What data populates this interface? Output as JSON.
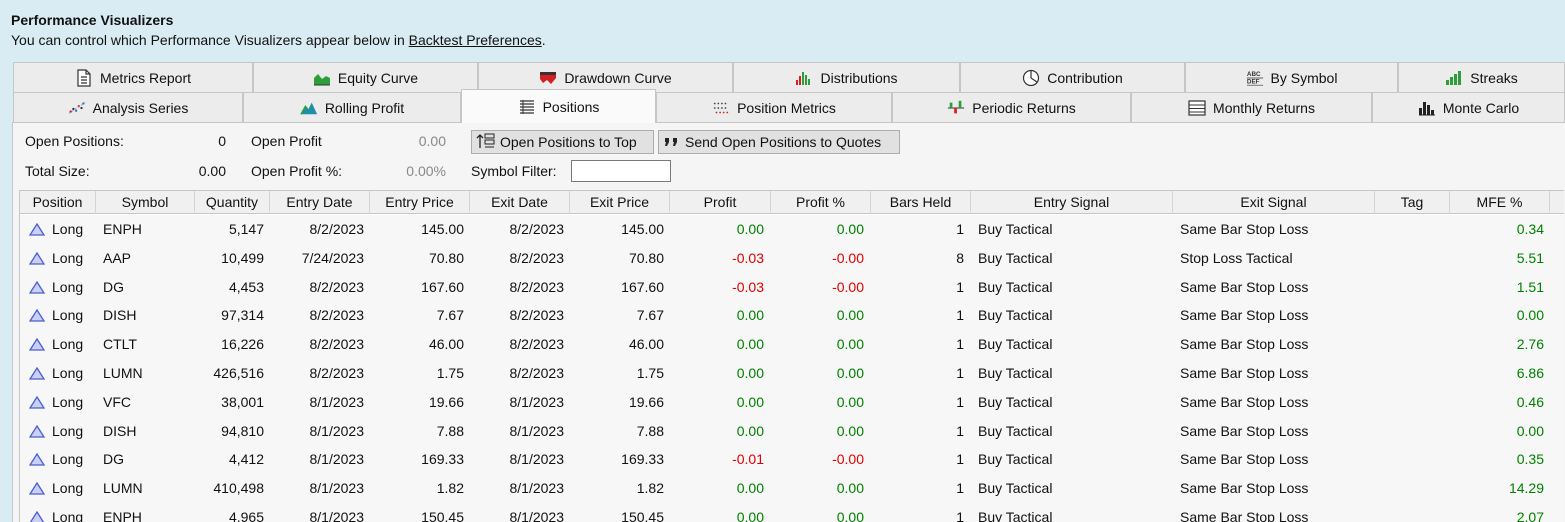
{
  "header": {
    "title": "Performance Visualizers",
    "subtitle_prefix": "You can control which Performance Visualizers appear below in ",
    "subtitle_link": "Backtest Preferences",
    "subtitle_suffix": "."
  },
  "tabs_row1": [
    {
      "label": "Metrics Report",
      "icon": "document-icon"
    },
    {
      "label": "Equity Curve",
      "icon": "area-chart-icon"
    },
    {
      "label": "Drawdown Curve",
      "icon": "drawdown-icon"
    },
    {
      "label": "Distributions",
      "icon": "histogram-icon"
    },
    {
      "label": "Contribution",
      "icon": "pie-chart-icon"
    },
    {
      "label": "By Symbol",
      "icon": "abc-table-icon"
    },
    {
      "label": "Streaks",
      "icon": "bar-chart-icon"
    }
  ],
  "tabs_row2": [
    {
      "label": "Analysis Series",
      "icon": "scatter-icon"
    },
    {
      "label": "Rolling Profit",
      "icon": "mountain-chart-icon"
    },
    {
      "label": "Positions",
      "icon": "list-icon",
      "active": true
    },
    {
      "label": "Position Metrics",
      "icon": "dots-grid-icon"
    },
    {
      "label": "Periodic Returns",
      "icon": "plus-minus-bars-icon"
    },
    {
      "label": "Monthly Returns",
      "icon": "calendar-grid-icon"
    },
    {
      "label": "Monte Carlo",
      "icon": "dark-bars-icon"
    }
  ],
  "stats": {
    "open_positions_label": "Open Positions:",
    "open_positions_value": "0",
    "open_profit_label": "Open Profit",
    "open_profit_value": "0.00",
    "total_size_label": "Total Size:",
    "total_size_value": "0.00",
    "open_profit_pct_label": "Open Profit %:",
    "open_profit_pct_value": "0.00%",
    "symbol_filter_label": "Symbol Filter:",
    "symbol_filter_value": ""
  },
  "buttons": {
    "open_to_top": "Open Positions to Top",
    "send_to_quotes": "Send Open Positions to Quotes"
  },
  "columns": [
    "Position",
    "Symbol",
    "Quantity",
    "Entry Date",
    "Entry Price",
    "Exit Date",
    "Exit Price",
    "Profit",
    "Profit %",
    "Bars Held",
    "Entry Signal",
    "Exit Signal",
    "Tag",
    "MFE %"
  ],
  "rows": [
    {
      "position": "Long",
      "symbol": "ENPH",
      "quantity": "5,147",
      "entry_date": "8/2/2023",
      "entry_price": "145.00",
      "exit_date": "8/2/2023",
      "exit_price": "145.00",
      "profit": "0.00",
      "profit_pct": "0.00",
      "bars_held": "1",
      "entry_signal": "Buy Tactical",
      "exit_signal": "Same Bar Stop Loss",
      "tag": "",
      "mfe": "0.34"
    },
    {
      "position": "Long",
      "symbol": "AAP",
      "quantity": "10,499",
      "entry_date": "7/24/2023",
      "entry_price": "70.80",
      "exit_date": "8/2/2023",
      "exit_price": "70.80",
      "profit": "-0.03",
      "profit_pct": "-0.00",
      "bars_held": "8",
      "entry_signal": "Buy Tactical",
      "exit_signal": "Stop Loss Tactical",
      "tag": "",
      "mfe": "5.51"
    },
    {
      "position": "Long",
      "symbol": "DG",
      "quantity": "4,453",
      "entry_date": "8/2/2023",
      "entry_price": "167.60",
      "exit_date": "8/2/2023",
      "exit_price": "167.60",
      "profit": "-0.03",
      "profit_pct": "-0.00",
      "bars_held": "1",
      "entry_signal": "Buy Tactical",
      "exit_signal": "Same Bar Stop Loss",
      "tag": "",
      "mfe": "1.51"
    },
    {
      "position": "Long",
      "symbol": "DISH",
      "quantity": "97,314",
      "entry_date": "8/2/2023",
      "entry_price": "7.67",
      "exit_date": "8/2/2023",
      "exit_price": "7.67",
      "profit": "0.00",
      "profit_pct": "0.00",
      "bars_held": "1",
      "entry_signal": "Buy Tactical",
      "exit_signal": "Same Bar Stop Loss",
      "tag": "",
      "mfe": "0.00"
    },
    {
      "position": "Long",
      "symbol": "CTLT",
      "quantity": "16,226",
      "entry_date": "8/2/2023",
      "entry_price": "46.00",
      "exit_date": "8/2/2023",
      "exit_price": "46.00",
      "profit": "0.00",
      "profit_pct": "0.00",
      "bars_held": "1",
      "entry_signal": "Buy Tactical",
      "exit_signal": "Same Bar Stop Loss",
      "tag": "",
      "mfe": "2.76"
    },
    {
      "position": "Long",
      "symbol": "LUMN",
      "quantity": "426,516",
      "entry_date": "8/2/2023",
      "entry_price": "1.75",
      "exit_date": "8/2/2023",
      "exit_price": "1.75",
      "profit": "0.00",
      "profit_pct": "0.00",
      "bars_held": "1",
      "entry_signal": "Buy Tactical",
      "exit_signal": "Same Bar Stop Loss",
      "tag": "",
      "mfe": "6.86"
    },
    {
      "position": "Long",
      "symbol": "VFC",
      "quantity": "38,001",
      "entry_date": "8/1/2023",
      "entry_price": "19.66",
      "exit_date": "8/1/2023",
      "exit_price": "19.66",
      "profit": "0.00",
      "profit_pct": "0.00",
      "bars_held": "1",
      "entry_signal": "Buy Tactical",
      "exit_signal": "Same Bar Stop Loss",
      "tag": "",
      "mfe": "0.46"
    },
    {
      "position": "Long",
      "symbol": "DISH",
      "quantity": "94,810",
      "entry_date": "8/1/2023",
      "entry_price": "7.88",
      "exit_date": "8/1/2023",
      "exit_price": "7.88",
      "profit": "0.00",
      "profit_pct": "0.00",
      "bars_held": "1",
      "entry_signal": "Buy Tactical",
      "exit_signal": "Same Bar Stop Loss",
      "tag": "",
      "mfe": "0.00"
    },
    {
      "position": "Long",
      "symbol": "DG",
      "quantity": "4,412",
      "entry_date": "8/1/2023",
      "entry_price": "169.33",
      "exit_date": "8/1/2023",
      "exit_price": "169.33",
      "profit": "-0.01",
      "profit_pct": "-0.00",
      "bars_held": "1",
      "entry_signal": "Buy Tactical",
      "exit_signal": "Same Bar Stop Loss",
      "tag": "",
      "mfe": "0.35"
    },
    {
      "position": "Long",
      "symbol": "LUMN",
      "quantity": "410,498",
      "entry_date": "8/1/2023",
      "entry_price": "1.82",
      "exit_date": "8/1/2023",
      "exit_price": "1.82",
      "profit": "0.00",
      "profit_pct": "0.00",
      "bars_held": "1",
      "entry_signal": "Buy Tactical",
      "exit_signal": "Same Bar Stop Loss",
      "tag": "",
      "mfe": "14.29"
    },
    {
      "position": "Long",
      "symbol": "ENPH",
      "quantity": "4,965",
      "entry_date": "8/1/2023",
      "entry_price": "150.45",
      "exit_date": "8/1/2023",
      "exit_price": "150.45",
      "profit": "0.00",
      "profit_pct": "0.00",
      "bars_held": "1",
      "entry_signal": "Buy Tactical",
      "exit_signal": "Same Bar Stop Loss",
      "tag": "",
      "mfe": "2.07"
    }
  ],
  "colors": {
    "positive": "#008000",
    "negative": "#e00000",
    "header_bg": "#d9ecf3",
    "long_triangle": "#4a5fd0"
  }
}
